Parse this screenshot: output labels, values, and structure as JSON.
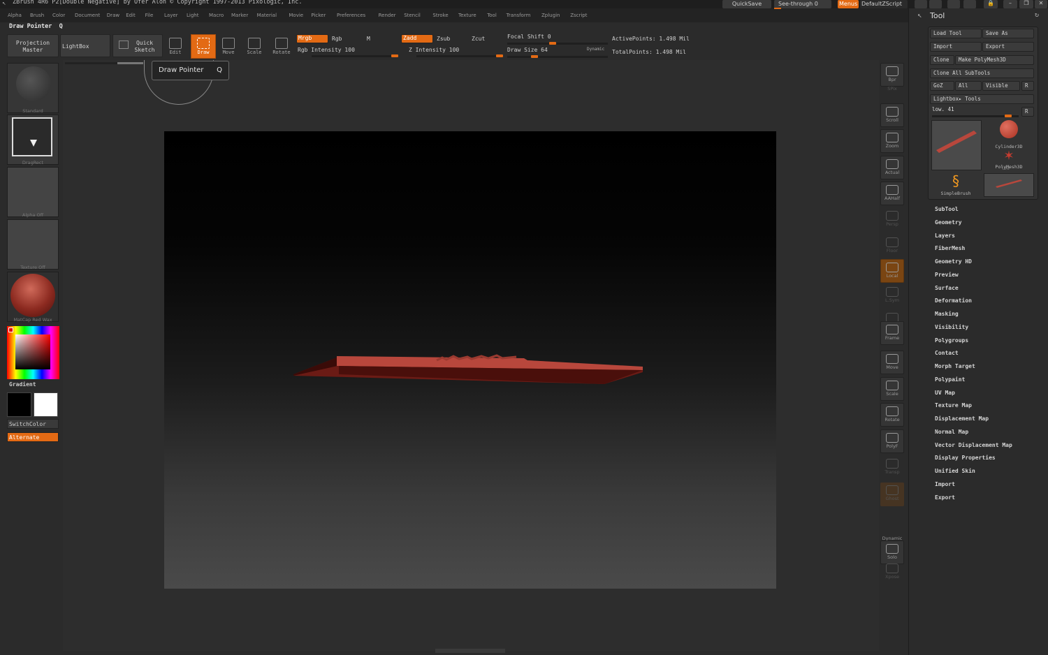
{
  "window": {
    "title": "ZBrush 4R6 P2[Double Negative] by Ofer Alon © Copyright 1997-2013 Pixologic, Inc."
  },
  "menu": [
    "Alpha",
    "Brush",
    "Color",
    "Document",
    "Draw",
    "Edit",
    "File",
    "Layer",
    "Light",
    "Macro",
    "Marker",
    "Material",
    "Movie",
    "Picker",
    "Preferences",
    "Render",
    "Stencil",
    "Stroke",
    "Texture",
    "Tool",
    "Transform",
    "Zplugin",
    "Zscript"
  ],
  "topright": {
    "quicksave": "QuickSave",
    "seethrough": "See-through",
    "seethrough_val": "0",
    "menus": "Menus",
    "script": "DefaultZScript"
  },
  "status": {
    "current_tool": "Draw Pointer",
    "hotkey": "Q"
  },
  "toolbar": {
    "projection_master": "Projection Master",
    "lightbox": "LightBox",
    "quick_sketch": "Quick Sketch",
    "edit": "Edit",
    "draw": "Draw",
    "move": "Move",
    "scale": "Scale",
    "rotate": "Rotate",
    "mrgb": "Mrgb",
    "rgb": "Rgb",
    "m": "M",
    "rgb_intensity": "Rgb Intensity 100",
    "zadd": "Zadd",
    "zsub": "Zsub",
    "zcut": "Zcut",
    "z_intensity": "Z Intensity 100",
    "focal_shift": "Focal Shift 0",
    "draw_size": "Draw Size 64",
    "dynamic": "Dynamic",
    "active_points": "ActivePoints: 1.498 Mil",
    "total_points": "TotalPoints: 1.498 Mil",
    "rgb_intensity_value": 100,
    "z_intensity_value": 100,
    "focal_shift_value": 0,
    "draw_size_value": 64
  },
  "left": {
    "brush": "Standard",
    "stroke": "DragRect",
    "alpha": "Alpha Off",
    "texture": "Texture Off",
    "material": "MatCap Red Wax",
    "gradient": "Gradient",
    "switchcolor": "SwitchColor",
    "alternate": "Alternate"
  },
  "rightstrip": [
    "Bpr",
    "SPix",
    "Scroll",
    "Zoom",
    "Actual",
    "AAHalf",
    "Persp",
    "Floor",
    "Local",
    "L.Sym",
    "Xyz",
    "Frame",
    "Move",
    "Scale",
    "Rotate",
    "PolyF",
    "Transp",
    "Ghost",
    "Dynamic",
    "Solo",
    "Xpose"
  ],
  "tool": {
    "title": "Tool",
    "load": "Load Tool",
    "save": "Save As",
    "import": "Import",
    "export": "Export",
    "clone": "Clone",
    "make_poly": "Make PolyMesh3D",
    "clone_all": "Clone All SubTools",
    "goz": "GoZ",
    "all": "All",
    "visible": "Visible",
    "r": "R",
    "lightbox_tools": "Lightbox▸ Tools",
    "current": "low. 41",
    "current_value": 41,
    "thumbs": [
      "low",
      "Cylinder3D",
      "PolyMesh3D",
      "SimpleBrush",
      "low"
    ],
    "sections": [
      "SubTool",
      "Geometry",
      "Layers",
      "FiberMesh",
      "Geometry HD",
      "Preview",
      "Surface",
      "Deformation",
      "Masking",
      "Visibility",
      "Polygroups",
      "Contact",
      "Morph Target",
      "Polypaint",
      "UV Map",
      "Texture Map",
      "Displacement Map",
      "Normal Map",
      "Vector Displacement Map",
      "Display Properties",
      "Unified Skin",
      "Import",
      "Export"
    ]
  },
  "colors": {
    "accent": "#e36a14",
    "mesh": "#b8473c"
  }
}
